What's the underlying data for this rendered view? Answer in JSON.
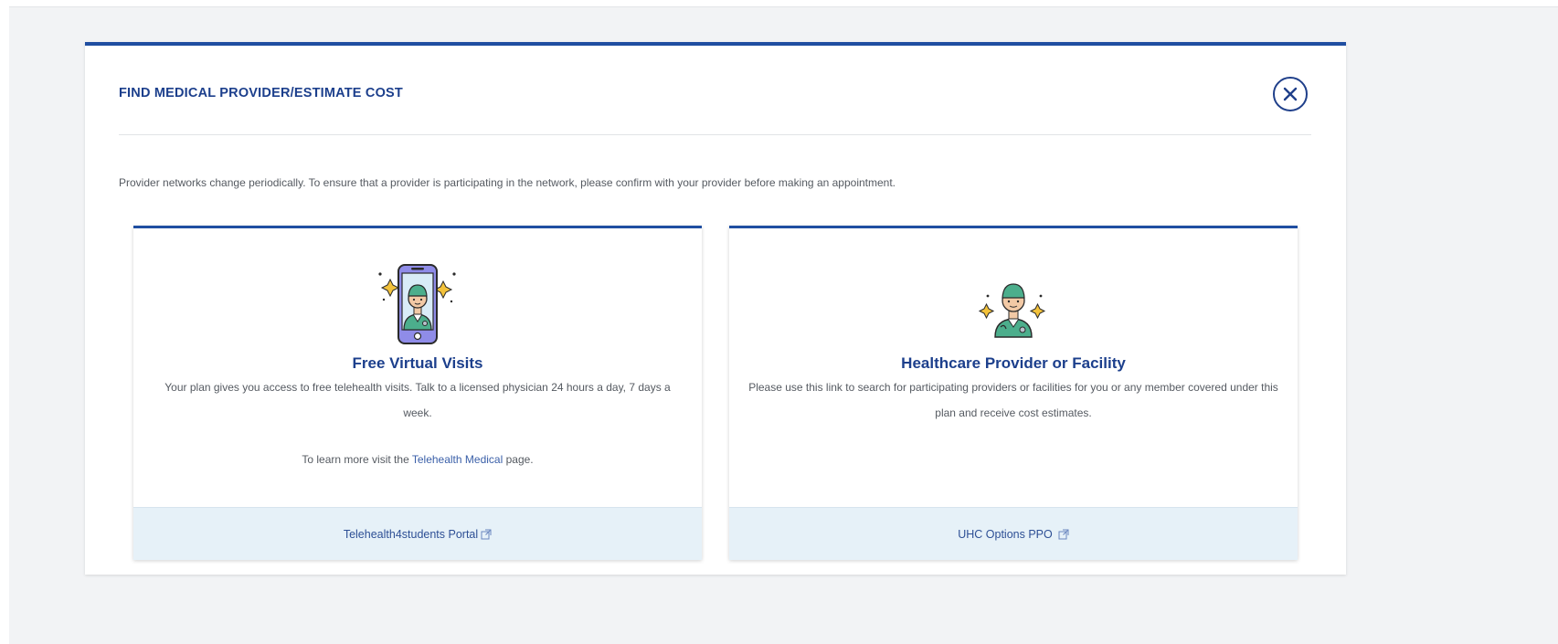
{
  "panel": {
    "title": "FIND MEDICAL PROVIDER/ESTIMATE COST",
    "notice": "Provider networks change periodically. To ensure that a provider is participating in the network, please confirm with your provider before making an appointment."
  },
  "cards": [
    {
      "title": "Free Virtual Visits",
      "description": "Your plan gives you access to free telehealth visits. Talk to a licensed physician 24 hours a day, 7 days a week.",
      "more_prefix": "To learn more visit the ",
      "more_link": "Telehealth Medical",
      "more_suffix": " page.",
      "footer_link": "Telehealth4students Portal",
      "icon": "phone-doctor-icon"
    },
    {
      "title": "Healthcare Provider or Facility",
      "description": "Please use this link to search for participating providers or facilities for you or any member covered under this plan and receive cost estimates.",
      "footer_link": "UHC Options PPO",
      "icon": "doctor-icon"
    }
  ],
  "colors": {
    "accent": "#1f4ea1",
    "title": "#1c3f8c",
    "footer_bg": "#e6f1f8",
    "doctor_green": "#4cae8c",
    "phone_purple": "#8f8ce8"
  }
}
